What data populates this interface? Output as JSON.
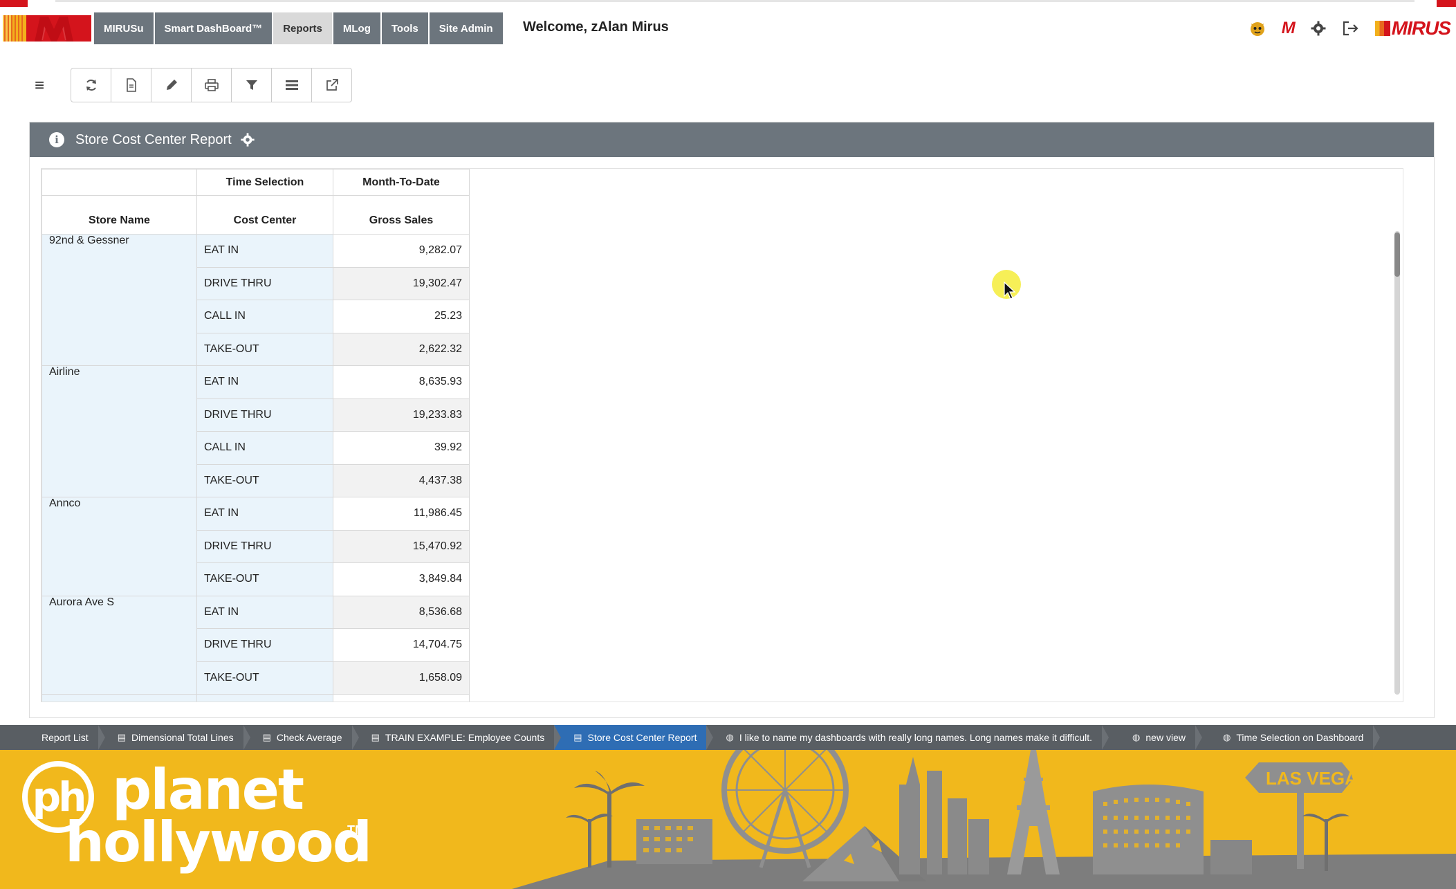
{
  "nav": {
    "tabs": [
      {
        "label": "MIRUSu"
      },
      {
        "label": "Smart DashBoard™"
      },
      {
        "label": "Reports"
      },
      {
        "label": "MLog"
      },
      {
        "label": "Tools"
      },
      {
        "label": "Site Admin"
      }
    ],
    "active_tab": "Reports",
    "welcome": "Welcome, zAlan Mirus",
    "brand_mini": "M",
    "brand_word": "MIRUS",
    "icons": [
      "mascot-icon",
      "m-logo-icon",
      "gear-icon",
      "sign-out-icon"
    ]
  },
  "toolbar": {
    "buttons": [
      "refresh-icon",
      "document-icon",
      "pencil-icon",
      "print-icon",
      "filter-icon",
      "list-icon",
      "external-link-icon"
    ]
  },
  "report": {
    "title": "Store Cost Center Report",
    "header_row1": {
      "col2": "Time Selection",
      "col3": "Month-To-Date"
    },
    "header_row2": {
      "col1": "Store Name",
      "col2": "Cost Center",
      "col3": "Gross Sales"
    },
    "rows": [
      {
        "store": "92nd & Gessner",
        "cost_center": "EAT IN",
        "gross_sales": "9,282.07"
      },
      {
        "store": "",
        "cost_center": "DRIVE THRU",
        "gross_sales": "19,302.47"
      },
      {
        "store": "",
        "cost_center": "CALL IN",
        "gross_sales": "25.23"
      },
      {
        "store": "",
        "cost_center": "TAKE-OUT",
        "gross_sales": "2,622.32"
      },
      {
        "store": "Airline",
        "cost_center": "EAT IN",
        "gross_sales": "8,635.93"
      },
      {
        "store": "",
        "cost_center": "DRIVE THRU",
        "gross_sales": "19,233.83"
      },
      {
        "store": "",
        "cost_center": "CALL IN",
        "gross_sales": "39.92"
      },
      {
        "store": "",
        "cost_center": "TAKE-OUT",
        "gross_sales": "4,437.38"
      },
      {
        "store": "Annco",
        "cost_center": "EAT IN",
        "gross_sales": "11,986.45"
      },
      {
        "store": "",
        "cost_center": "DRIVE THRU",
        "gross_sales": "15,470.92"
      },
      {
        "store": "",
        "cost_center": "TAKE-OUT",
        "gross_sales": "3,849.84"
      },
      {
        "store": "Aurora Ave S",
        "cost_center": "EAT IN",
        "gross_sales": "8,536.68"
      },
      {
        "store": "",
        "cost_center": "DRIVE THRU",
        "gross_sales": "14,704.75"
      },
      {
        "store": "",
        "cost_center": "TAKE-OUT",
        "gross_sales": "1,658.09"
      }
    ]
  },
  "breadcrumbs": [
    {
      "label": "Report List",
      "icon": ""
    },
    {
      "label": "Dimensional Total Lines",
      "icon": "document-icon"
    },
    {
      "label": "Check Average",
      "icon": "document-icon"
    },
    {
      "label": "TRAIN EXAMPLE: Employee Counts",
      "icon": "document-icon"
    },
    {
      "label": "Store Cost Center Report",
      "icon": "document-icon",
      "active": true
    },
    {
      "label": "I like to name my dashboards with really long names. Long names make it difficult.",
      "icon": "dashboard-icon"
    },
    {
      "label": "new view",
      "icon": "dashboard-icon"
    },
    {
      "label": "Time Selection on Dashboard",
      "icon": "dashboard-icon"
    }
  ],
  "banner": {
    "logo_mark": "ph",
    "line1": "planet",
    "line2": "hollywood",
    "tm": "TM",
    "sign_text": "LAS VEGAS",
    "colors": {
      "background": "#f1b81c",
      "skyline": "#8a8a8a"
    }
  }
}
